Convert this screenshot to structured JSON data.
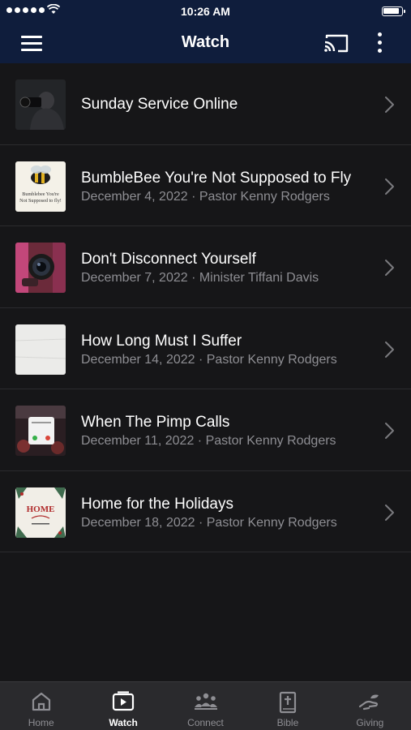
{
  "status_bar": {
    "time": "10:26 AM"
  },
  "nav": {
    "title": "Watch",
    "menu_icon": "hamburger-menu-icon",
    "cast_icon": "cast-icon",
    "more_icon": "more-vertical-icon"
  },
  "items": [
    {
      "title": "Sunday Service Online",
      "subtitle": "",
      "thumb_icon": "camera-operator-thumbnail"
    },
    {
      "title": "BumbleBee You're Not Supposed to Fly",
      "subtitle": "December 4, 2022 · Pastor Kenny Rodgers",
      "thumb_icon": "bumblebee-thumbnail",
      "thumb_text": "Bumblebee You're Not Supposed to fly!"
    },
    {
      "title": "Don't Disconnect Yourself",
      "subtitle": "December 7, 2022 · Minister Tiffani Davis",
      "thumb_icon": "camera-lens-thumbnail"
    },
    {
      "title": "How Long Must I Suffer",
      "subtitle": "December 14, 2022 · Pastor Kenny Rodgers",
      "thumb_icon": "white-texture-thumbnail"
    },
    {
      "title": "When The Pimp Calls",
      "subtitle": "December 11, 2022 · Pastor Kenny Rodgers",
      "thumb_icon": "phone-call-thumbnail"
    },
    {
      "title": "Home for the Holidays",
      "subtitle": "December 18, 2022 · Pastor Kenny Rodgers",
      "thumb_icon": "holiday-wreath-thumbnail",
      "thumb_text": "HOME"
    }
  ],
  "tabs": [
    {
      "label": "Home",
      "icon": "home-icon",
      "active": false
    },
    {
      "label": "Watch",
      "icon": "play-tv-icon",
      "active": true
    },
    {
      "label": "Connect",
      "icon": "group-icon",
      "active": false
    },
    {
      "label": "Bible",
      "icon": "bible-icon",
      "active": false
    },
    {
      "label": "Giving",
      "icon": "giving-hand-icon",
      "active": false
    }
  ],
  "colors": {
    "nav_background": "#0f1d3c",
    "list_background": "#161618",
    "tab_bar_background": "#2a2a2d",
    "subtitle_text": "#8e8e93"
  }
}
